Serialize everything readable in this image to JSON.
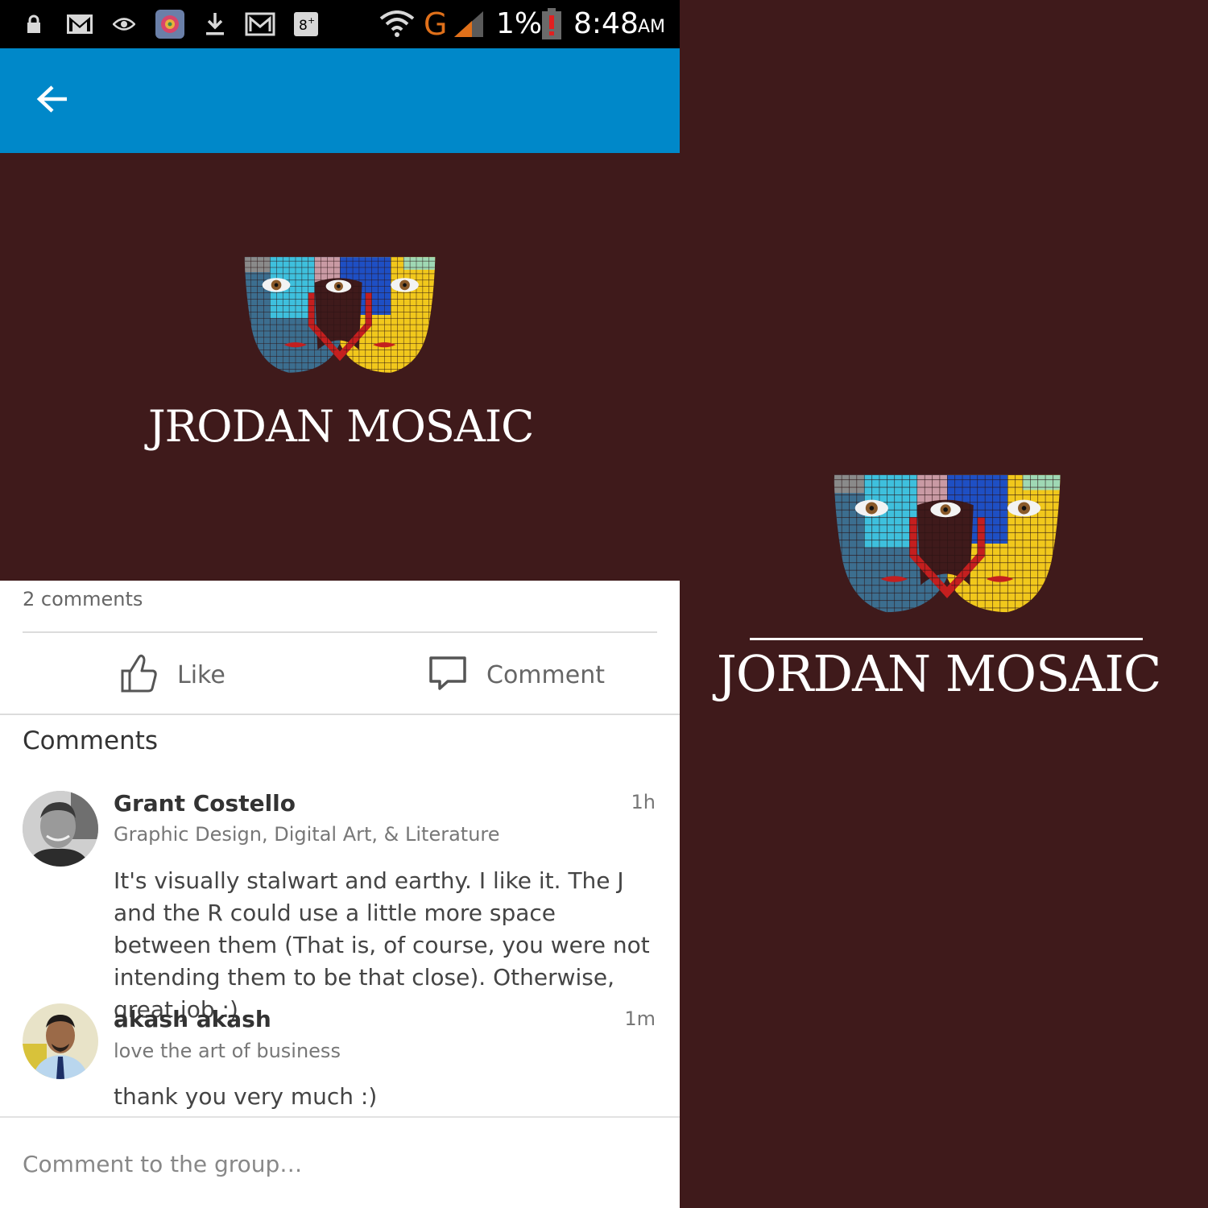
{
  "status_bar": {
    "network": "G",
    "battery": "1%",
    "time": "8:48",
    "ampm": "AM",
    "icons": [
      "lock-icon",
      "gmail-icon",
      "eye-icon",
      "app-icon",
      "download-icon",
      "gmail-outline-icon",
      "google-plus-icon",
      "wifi-icon",
      "signal-icon",
      "battery-low-icon"
    ]
  },
  "app_bar": {
    "back_icon": "arrow-left-icon",
    "color": "#0088c9"
  },
  "post": {
    "logo_text": "JRODAN MOSAIC",
    "background": "#3f1a1b"
  },
  "stats": {
    "comment_count": "2 comments"
  },
  "actions": {
    "like_label": "Like",
    "like_icon": "thumbs-up-icon",
    "comment_label": "Comment",
    "comment_icon": "speech-bubble-icon"
  },
  "comments": {
    "heading": "Comments",
    "items": [
      {
        "name": "Grant Costello",
        "headline": "Graphic Design, Digital Art, & Literature",
        "time": "1h",
        "text": "It's visually stalwart and earthy. I like it. The J and the R could use a little more space between them (That is, of course, you were not intending them to be that close). Otherwise, great job :)"
      },
      {
        "name": "akash akash",
        "headline": "love the art of business",
        "time": "1m",
        "text": "thank you very much :)"
      }
    ]
  },
  "input": {
    "placeholder": "Comment to the group…"
  },
  "side_logo": {
    "logo_text": "JORDAN MOSAIC"
  },
  "colors": {
    "maroon": "#3f1a1b",
    "blue": "#0088c9",
    "mosaic_blue": "#3c6e8f",
    "mosaic_cyan": "#3ec0dd",
    "mosaic_pink": "#c99aa4",
    "mosaic_royal": "#1e4fc4",
    "mosaic_yellow": "#f1c81c",
    "mosaic_red": "#c41f1f"
  }
}
